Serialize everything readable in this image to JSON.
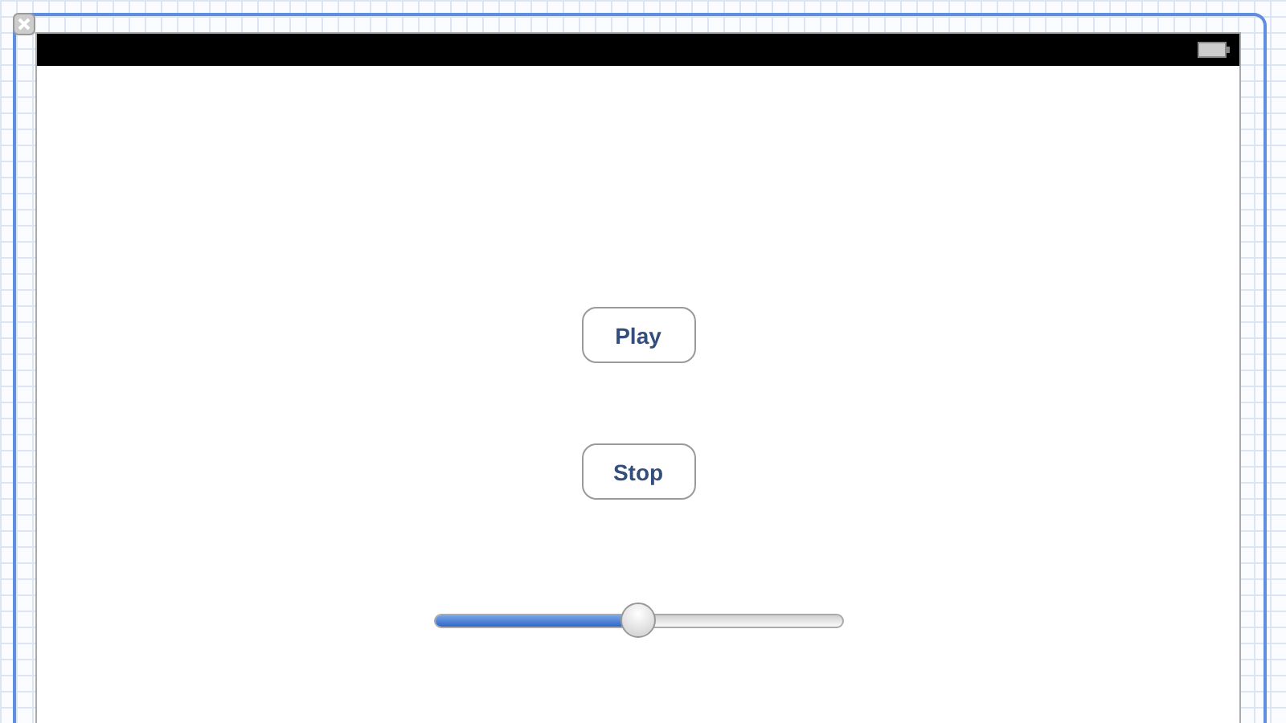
{
  "buttons": [
    {
      "label": "Play"
    },
    {
      "label": "Stop"
    }
  ],
  "slider": {
    "level": 0.5
  }
}
